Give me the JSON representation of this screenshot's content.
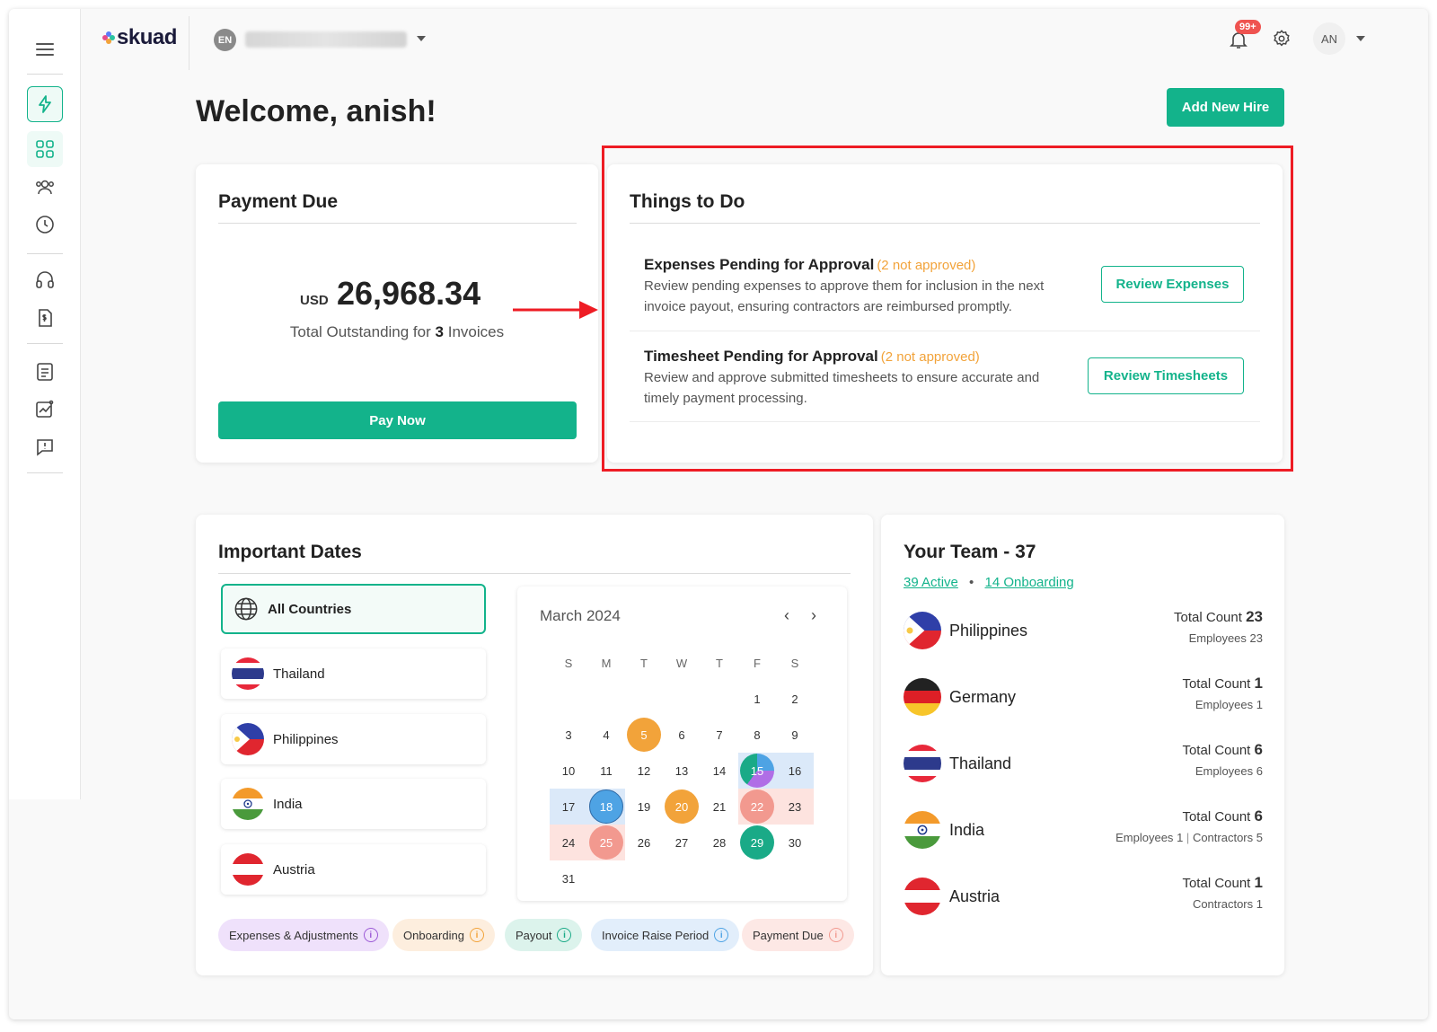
{
  "header": {
    "logo": "skuad",
    "workspace_badge": "EN",
    "notification_count": "99+",
    "user_initials": "AN"
  },
  "welcome": "Welcome, anish!",
  "add_hire_label": "Add New Hire",
  "payment": {
    "title": "Payment Due",
    "currency": "USD",
    "amount": "26,968.34",
    "subtitle_prefix": "Total Outstanding for",
    "invoice_count": "3",
    "subtitle_suffix": "Invoices",
    "pay_label": "Pay Now"
  },
  "todo": {
    "title": "Things to Do",
    "items": [
      {
        "title": "Expenses Pending for Approval",
        "tag": "(2 not approved)",
        "desc": "Review pending expenses to approve them for inclusion in the next invoice payout, ensuring contractors are reimbursed promptly.",
        "action": "Review Expenses"
      },
      {
        "title": "Timesheet Pending for Approval",
        "tag": "(2 not approved)",
        "desc": "Review and approve submitted timesheets to ensure accurate and timely payment processing.",
        "action": "Review Timesheets"
      }
    ]
  },
  "dates": {
    "title": "Important Dates",
    "countries": [
      "All Countries",
      "Thailand",
      "Philippines",
      "India",
      "Austria"
    ],
    "calendar": {
      "month": "March 2024",
      "dow": [
        "S",
        "M",
        "T",
        "W",
        "T",
        "F",
        "S"
      ]
    },
    "legend": [
      "Expenses & Adjustments",
      "Onboarding",
      "Payout",
      "Invoice Raise Period",
      "Payment Due"
    ]
  },
  "team": {
    "title": "Your Team - 37",
    "active": "39 Active",
    "onboarding": "14 Onboarding",
    "total_label": "Total Count",
    "rows": [
      {
        "country": "Philippines",
        "total": "23",
        "detail_label": "Employees",
        "detail_value": "23"
      },
      {
        "country": "Germany",
        "total": "1",
        "detail_label": "Employees",
        "detail_value": "1"
      },
      {
        "country": "Thailand",
        "total": "6",
        "detail_label": "Employees",
        "detail_value": "6"
      },
      {
        "country": "India",
        "total": "6",
        "detail_label": "Employees",
        "detail_value": "1",
        "detail2_label": "Contractors",
        "detail2_value": "5"
      },
      {
        "country": "Austria",
        "total": "1",
        "detail_label": "Contractors",
        "detail_value": "1"
      }
    ]
  },
  "colors": {
    "accent": "#13b38b",
    "highlight": "#ee1c24",
    "orange": "#f2a33a",
    "blue": "#4ea3e4",
    "salmon": "#f2998f"
  }
}
